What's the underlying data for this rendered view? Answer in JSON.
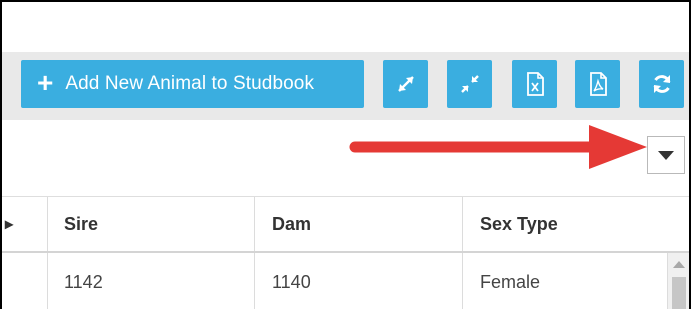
{
  "toolbar": {
    "add_label": "Add New Animal to Studbook",
    "icons": [
      "expand-icon",
      "collapse-icon",
      "excel-export-icon",
      "pdf-export-icon",
      "refresh-icon"
    ]
  },
  "colors": {
    "button": "#3aaee0",
    "toolbar_band": "#e9e9e9",
    "arrow": "#e53935"
  },
  "table": {
    "columns": [
      "Sire",
      "Dam",
      "Sex Type"
    ],
    "rows": [
      {
        "sire": "1142",
        "dam": "1140",
        "sex_type": "Female"
      }
    ]
  }
}
